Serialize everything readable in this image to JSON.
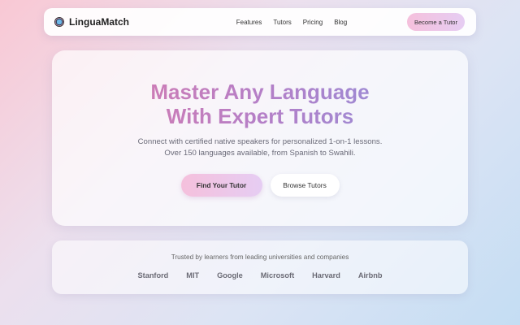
{
  "nav": {
    "brand": "LinguaMatch",
    "links": [
      "Features",
      "Tutors",
      "Pricing",
      "Blog"
    ],
    "cta": "Become a Tutor"
  },
  "hero": {
    "title_line1": "Master Any Language",
    "title_line2": "With Expert Tutors",
    "subtitle": "Connect with certified native speakers for personalized 1-on-1 lessons. Over 150 languages available, from Spanish to Swahili.",
    "primary_button": "Find Your Tutor",
    "secondary_button": "Browse Tutors"
  },
  "trust": {
    "tagline": "Trusted by learners from leading universities and companies",
    "logos": [
      "Stanford",
      "MIT",
      "Google",
      "Microsoft",
      "Harvard",
      "Airbnb"
    ]
  },
  "colors": {
    "accent_pink": "#f5c0dc",
    "accent_lavender": "#e6cdf3",
    "title_gradient_start": "#e07aa8",
    "title_gradient_end": "#8c93dd"
  }
}
